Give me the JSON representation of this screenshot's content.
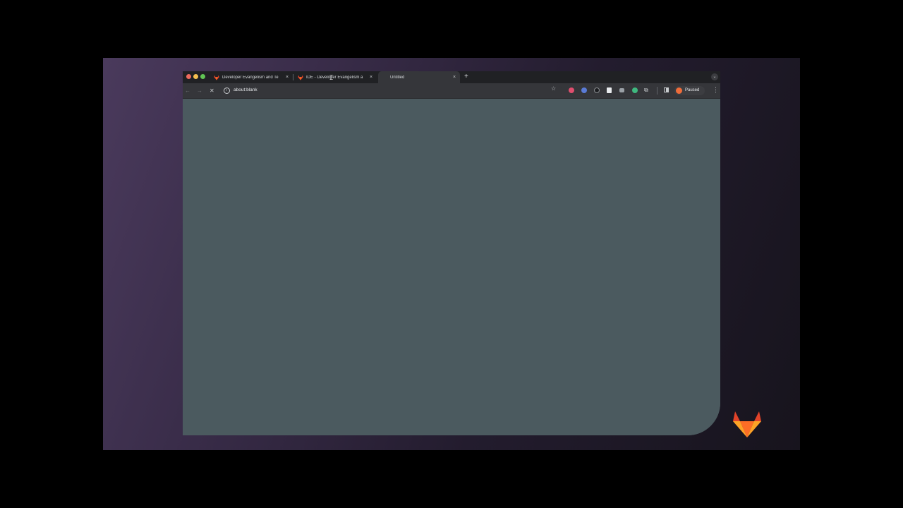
{
  "browser": {
    "tabs": [
      {
        "title": "Developer Evangelism and Te",
        "icon": "gitlab-icon",
        "active": false
      },
      {
        "title": "IDE - Developer Evangelism a",
        "icon": "gitlab-icon",
        "active": false
      },
      {
        "title": "Untitled",
        "icon": "none",
        "active": true
      }
    ],
    "new_tab_label": "+",
    "tab_close_glyph": "×",
    "address": "about:blank",
    "profile_label": "Paused",
    "extensions": [
      "extension-red-icon",
      "extension-blue-icon",
      "extension-dark-icon",
      "extension-book-icon",
      "extension-camera-icon",
      "extension-green-icon"
    ]
  },
  "colors": {
    "tabstrip": "#202124",
    "toolbar": "#35363a",
    "page_background": "#4b5a5f",
    "slide_gradient_start": "#4a3a5c",
    "slide_gradient_end": "#17141d"
  },
  "branding": {
    "logo": "gitlab-tanuki-logo"
  }
}
